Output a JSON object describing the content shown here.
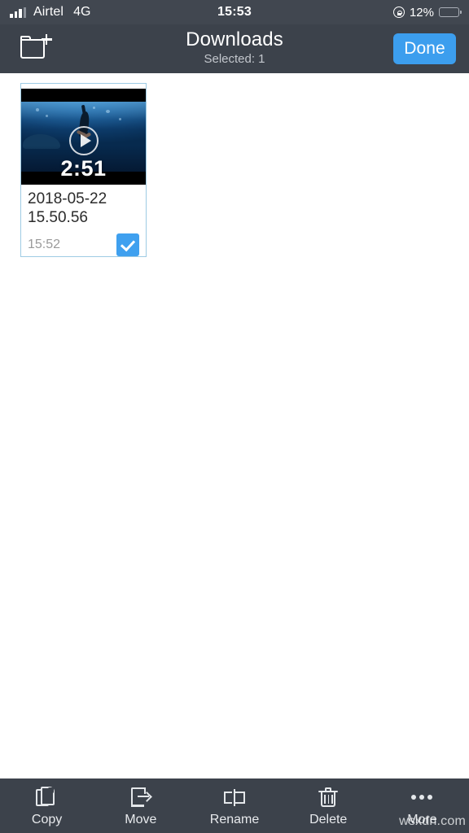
{
  "status_bar": {
    "carrier": "Airtel",
    "network": "4G",
    "time": "15:53",
    "battery_percent": "12%",
    "battery_level": 12,
    "rotation_lock_icon": "rotation-lock-icon",
    "signal_bars_filled": 3,
    "signal_bars_total": 4
  },
  "nav_bar": {
    "new_folder_icon": "new-folder-icon",
    "title": "Downloads",
    "subtitle": "Selected: 1",
    "done_label": "Done"
  },
  "files": [
    {
      "name": "2018-05-22 15.50.56",
      "time": "15:52",
      "duration": "2:51",
      "type": "video",
      "selected": true,
      "play_icon": "play-icon",
      "check_icon": "check-icon"
    }
  ],
  "toolbar": {
    "items": [
      {
        "label": "Copy",
        "icon": "copy-icon"
      },
      {
        "label": "Move",
        "icon": "move-icon"
      },
      {
        "label": "Rename",
        "icon": "rename-icon"
      },
      {
        "label": "Delete",
        "icon": "trash-icon"
      },
      {
        "label": "More",
        "icon": "ellipsis-icon"
      }
    ]
  },
  "watermark": "wsxdn.com",
  "colors": {
    "chrome": "#3c424b",
    "status_bar": "#414750",
    "accent": "#3c9eee",
    "checkbox": "#3fa0ef",
    "card_border": "#9ecbe4",
    "battery_red": "#ef3c36",
    "content_bg": "#ffffff"
  }
}
